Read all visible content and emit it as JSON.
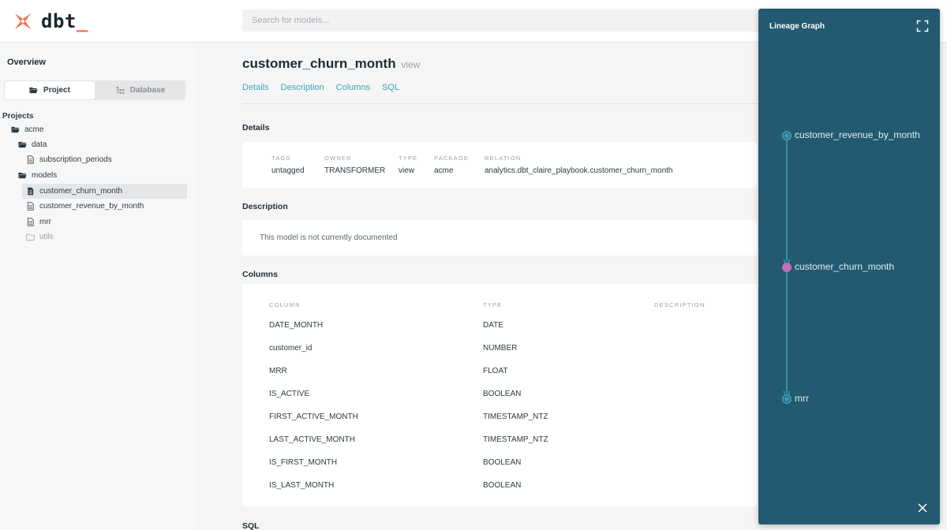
{
  "app": {
    "logo_text": "dbt",
    "logo_cursor": "_"
  },
  "search": {
    "placeholder": "Search for models..."
  },
  "sidebar": {
    "overview": "Overview",
    "toggle": {
      "project": "Project",
      "database": "Database"
    },
    "projects_label": "Projects",
    "tree": [
      {
        "label": "acme",
        "icon": "folder-open-icon"
      },
      {
        "label": "data",
        "icon": "folder-open-icon"
      },
      {
        "label": "subscription_periods",
        "icon": "file-icon"
      },
      {
        "label": "models",
        "icon": "folder-open-icon"
      },
      {
        "label": "customer_churn_month",
        "icon": "file-filled-icon",
        "selected": true
      },
      {
        "label": "customer_revenue_by_month",
        "icon": "file-icon"
      },
      {
        "label": "mrr",
        "icon": "file-icon"
      },
      {
        "label": "utils",
        "icon": "folder-closed-icon"
      }
    ]
  },
  "model": {
    "name": "customer_churn_month",
    "kind": "view",
    "tabs": [
      "Details",
      "Description",
      "Columns",
      "SQL"
    ]
  },
  "details": {
    "heading": "Details",
    "fields": [
      {
        "label": "TAGS",
        "value": "untagged"
      },
      {
        "label": "OWNER",
        "value": "TRANSFORMER"
      },
      {
        "label": "TYPE",
        "value": "view"
      },
      {
        "label": "PACKAGE",
        "value": "acme"
      },
      {
        "label": "RELATION",
        "value": "analytics.dbt_claire_playbook.customer_churn_month"
      }
    ]
  },
  "description": {
    "heading": "Description",
    "text": "This model is not currently documented"
  },
  "columns": {
    "heading": "Columns",
    "headers": [
      "COLUMN",
      "TYPE",
      "DESCRIPTION"
    ],
    "rows": [
      {
        "column": "DATE_MONTH",
        "type": "DATE"
      },
      {
        "column": "customer_id",
        "type": "NUMBER"
      },
      {
        "column": "MRR",
        "type": "FLOAT"
      },
      {
        "column": "IS_ACTIVE",
        "type": "BOOLEAN"
      },
      {
        "column": "FIRST_ACTIVE_MONTH",
        "type": "TIMESTAMP_NTZ"
      },
      {
        "column": "LAST_ACTIVE_MONTH",
        "type": "TIMESTAMP_NTZ"
      },
      {
        "column": "IS_FIRST_MONTH",
        "type": "BOOLEAN"
      },
      {
        "column": "IS_LAST_MONTH",
        "type": "BOOLEAN"
      }
    ]
  },
  "sql": {
    "heading": "SQL"
  },
  "lineage": {
    "title": "Lineage Graph",
    "nodes": [
      {
        "label": "customer_revenue_by_month",
        "current": false
      },
      {
        "label": "customer_churn_month",
        "current": true
      },
      {
        "label": "mrr",
        "current": false
      }
    ]
  },
  "colors": {
    "brand": "#ff694a",
    "link": "#3aa6b4",
    "lineage_bg": "#235a71",
    "current_node": "#c36eb7",
    "node": "#3c9ab4"
  }
}
